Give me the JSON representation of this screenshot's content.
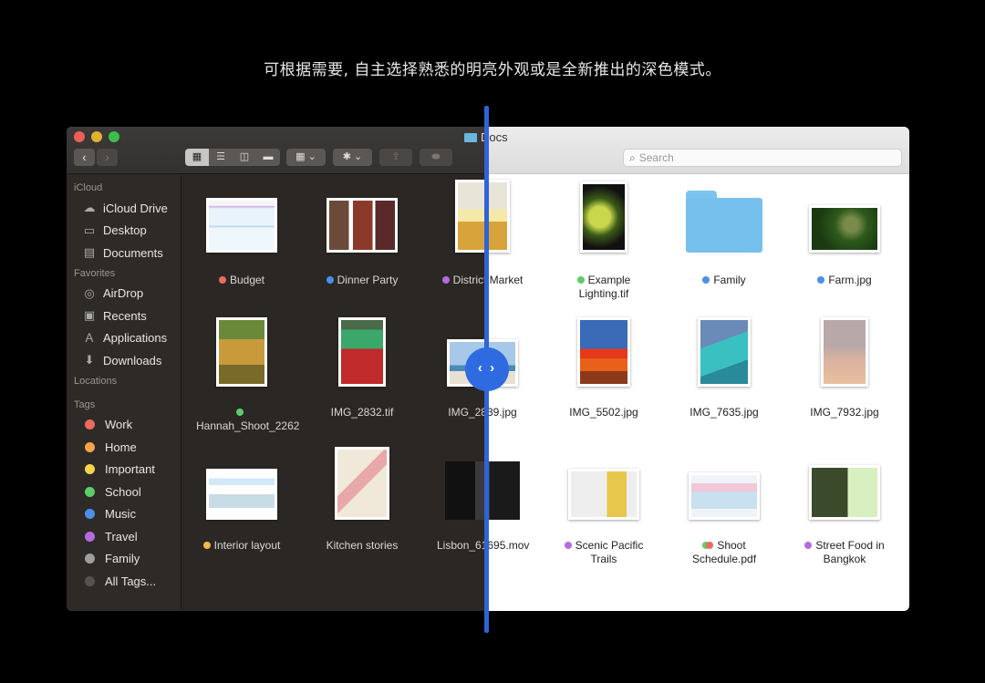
{
  "caption": "可根据需要, 自主选择熟悉的明亮外观或是全新推出的深色模式。",
  "window": {
    "title": "Docs",
    "search_placeholder": "Search",
    "nav": {
      "back": "‹",
      "forward": "›"
    },
    "toolbar": {
      "icon_view": "▦",
      "list_view": "☰",
      "column_view": "◫",
      "gallery_view": "▬",
      "group": "▦ ⌄",
      "action": "✱ ⌄",
      "share": "⇪",
      "tags": "⬬"
    }
  },
  "sidebar": {
    "sections": [
      {
        "header": "iCloud",
        "items": [
          {
            "label": "iCloud Drive",
            "icon": "☁"
          },
          {
            "label": "Desktop",
            "icon": "▭"
          },
          {
            "label": "Documents",
            "icon": "▤"
          }
        ]
      },
      {
        "header": "Favorites",
        "items": [
          {
            "label": "AirDrop",
            "icon": "◎"
          },
          {
            "label": "Recents",
            "icon": "▣"
          },
          {
            "label": "Applications",
            "icon": "Ａ"
          },
          {
            "label": "Downloads",
            "icon": "⬇"
          }
        ]
      },
      {
        "header": "Locations",
        "items": []
      }
    ],
    "tags_header": "Tags",
    "tags": [
      {
        "label": "Work",
        "color": "#ec6a62"
      },
      {
        "label": "Home",
        "color": "#f2a54a"
      },
      {
        "label": "Important",
        "color": "#f3d44a"
      },
      {
        "label": "School",
        "color": "#5ccd6a"
      },
      {
        "label": "Music",
        "color": "#4a90e8"
      },
      {
        "label": "Travel",
        "color": "#b66ae0"
      },
      {
        "label": "Family",
        "color": "#9e9e9e"
      },
      {
        "label": "All Tags...",
        "color": "#55524f"
      }
    ]
  },
  "files": [
    {
      "name": "Budget",
      "tag": "#ec6a62"
    },
    {
      "name": "Dinner Party",
      "tag": "#4a90e8"
    },
    {
      "name": "District Market",
      "tag": "#b66ae0"
    },
    {
      "name": "Example Lighting.tif",
      "tag": "#5ccd6a"
    },
    {
      "name": "Family",
      "tag": "#4a90e8"
    },
    {
      "name": "Farm.jpg",
      "tag": "#4a90e8"
    },
    {
      "name": "Hannah_Shoot_2262",
      "tag": "#5ccd6a"
    },
    {
      "name": "IMG_2832.tif",
      "tag": null
    },
    {
      "name": "IMG_2839.jpg",
      "tag": null
    },
    {
      "name": "IMG_5502.jpg",
      "tag": null
    },
    {
      "name": "IMG_7635.jpg",
      "tag": null
    },
    {
      "name": "IMG_7932.jpg",
      "tag": null
    },
    {
      "name": "Interior layout",
      "tag": "#f2b84a"
    },
    {
      "name": "Kitchen stories",
      "tag": null
    },
    {
      "name": "Lisbon_61695.mov",
      "tag": null
    },
    {
      "name": "Scenic Pacific Trails",
      "tag": "#b66ae0"
    },
    {
      "name": "Shoot Schedule.pdf",
      "tag": "#5ccd6a",
      "tag2": "#ec6a62"
    },
    {
      "name": "Street Food in Bangkok",
      "tag": "#b66ae0"
    }
  ],
  "compare_handle": "‹ ›"
}
